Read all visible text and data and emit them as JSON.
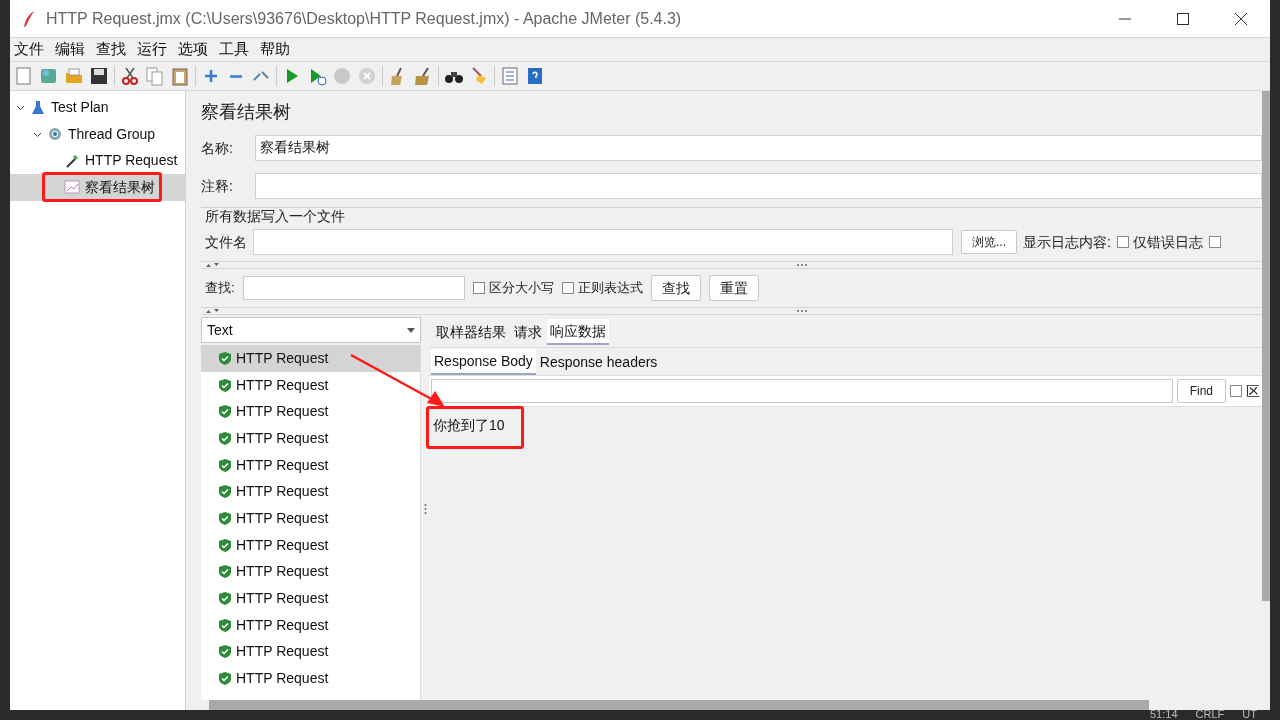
{
  "window": {
    "title": "HTTP Request.jmx (C:\\Users\\93676\\Desktop\\HTTP Request.jmx) - Apache JMeter (5.4.3)"
  },
  "menu": [
    "文件",
    "编辑",
    "查找",
    "运行",
    "选项",
    "工具",
    "帮助"
  ],
  "tree": [
    {
      "label": "Test Plan",
      "kind": "plan",
      "expanded": true,
      "selected": false,
      "children": [
        {
          "label": "Thread Group",
          "kind": "group",
          "expanded": true,
          "selected": false,
          "children": [
            {
              "label": "HTTP Request",
              "kind": "sampler",
              "selected": false
            },
            {
              "label": "察看结果树",
              "kind": "listener",
              "selected": true
            }
          ]
        }
      ]
    }
  ],
  "panel": {
    "title": "察看结果树",
    "name_label": "名称:",
    "name_value": "察看结果树",
    "comment_label": "注释:",
    "file_group": {
      "title": "所有数据写入一个文件",
      "file_label": "文件名",
      "browse_button": "浏览...",
      "log_label": "显示日志内容:",
      "options": [
        {
          "label": "仅错误日志",
          "checked": false
        },
        {
          "checked": false
        }
      ]
    },
    "search": {
      "label": "查找:",
      "options": [
        {
          "label": "区分大小写",
          "checked": false
        },
        {
          "label": "正则表达式",
          "checked": false
        }
      ],
      "buttons": [
        "查找",
        "重置"
      ]
    },
    "renderer": "Text",
    "results": [
      {
        "label": "HTTP Request",
        "selected": true
      },
      {
        "label": "HTTP Request",
        "selected": false
      },
      {
        "label": "HTTP Request",
        "selected": false
      },
      {
        "label": "HTTP Request",
        "selected": false
      },
      {
        "label": "HTTP Request",
        "selected": false
      },
      {
        "label": "HTTP Request",
        "selected": false
      },
      {
        "label": "HTTP Request",
        "selected": false
      },
      {
        "label": "HTTP Request",
        "selected": false
      },
      {
        "label": "HTTP Request",
        "selected": false
      },
      {
        "label": "HTTP Request",
        "selected": false
      },
      {
        "label": "HTTP Request",
        "selected": false
      },
      {
        "label": "HTTP Request",
        "selected": false
      },
      {
        "label": "HTTP Request",
        "selected": false
      }
    ],
    "tabs": [
      {
        "label": "取样器结果",
        "selected": false
      },
      {
        "label": "请求",
        "selected": false
      },
      {
        "label": "响应数据",
        "selected": true
      }
    ],
    "subtabs": [
      {
        "label": "Response Body",
        "selected": true
      },
      {
        "label": "Response headers",
        "selected": false
      }
    ],
    "find_button": "Find",
    "find_option": {
      "label": "区",
      "checked": false
    },
    "response_text": "你抢到了10"
  },
  "status_bar": [
    "51:14",
    "CRLF",
    "UT"
  ]
}
